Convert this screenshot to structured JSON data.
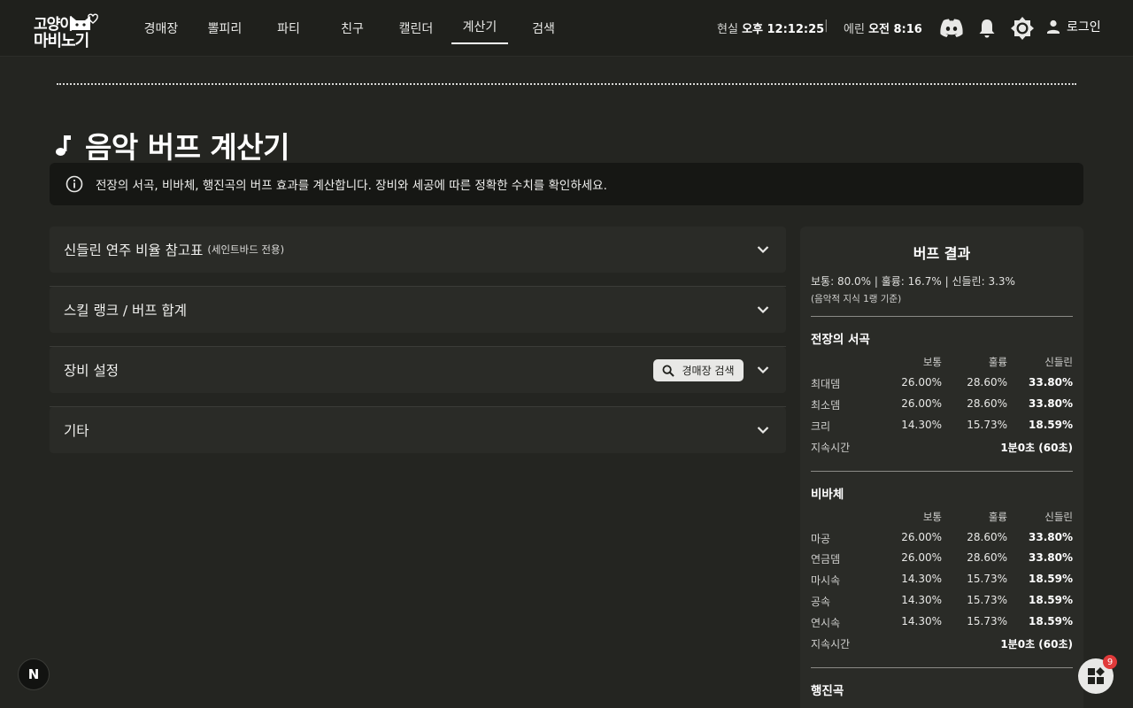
{
  "header": {
    "logo_line1": "고양이",
    "logo_line2": "마비노기",
    "nav": [
      {
        "label": "경매장"
      },
      {
        "label": "뽈피리"
      },
      {
        "label": "파티"
      },
      {
        "label": "친구"
      },
      {
        "label": "캘린더"
      },
      {
        "label": "계산기",
        "active": true
      },
      {
        "label": "검색"
      }
    ],
    "real_time_label": "현실",
    "real_time_value": "오후 12:12:25",
    "separator": "|",
    "erinn_time_label": "에린",
    "erinn_time_value": "오전 8:16",
    "icons": [
      "discord-icon",
      "bell-icon",
      "theme-toggle-icon",
      "user-icon"
    ],
    "login_label": "로그인"
  },
  "page": {
    "title": "음악 버프 계산기",
    "info": "전장의 서곡, 비바체, 행진곡의 버프 효과를 계산합니다. 장비와 세공에 따른 정확한 수치를 확인하세요."
  },
  "accordions": [
    {
      "label": "신들린 연주 비율 참고표",
      "sub": "(세인트바드 전용)"
    },
    {
      "label": "스킬 랭크 / 버프 합계"
    },
    {
      "label": "장비 설정",
      "button": "경매장 검색"
    },
    {
      "label": "기타"
    }
  ],
  "result": {
    "title": "버프 결과",
    "ratio_text": "보통: 80.0% | 훌륭: 16.7% | 신들린: 3.3%",
    "ratio_note": "(음악적 지식 1랭 기준)",
    "col_headers": [
      "보통",
      "훌륭",
      "신들린"
    ],
    "sections": [
      {
        "title": "전장의 서곡",
        "rows": [
          {
            "name": "최대뎀",
            "v": [
              "26.00%",
              "28.60%",
              "33.80%"
            ]
          },
          {
            "name": "최소뎀",
            "v": [
              "26.00%",
              "28.60%",
              "33.80%"
            ]
          },
          {
            "name": "크리",
            "v": [
              "14.30%",
              "15.73%",
              "18.59%"
            ]
          }
        ],
        "duration_label": "지속시간",
        "duration": "1분0초 (60초)"
      },
      {
        "title": "비바체",
        "rows": [
          {
            "name": "마공",
            "v": [
              "26.00%",
              "28.60%",
              "33.80%"
            ]
          },
          {
            "name": "연금뎀",
            "v": [
              "26.00%",
              "28.60%",
              "33.80%"
            ]
          },
          {
            "name": "마시속",
            "v": [
              "14.30%",
              "15.73%",
              "18.59%"
            ]
          },
          {
            "name": "공속",
            "v": [
              "14.30%",
              "15.73%",
              "18.59%"
            ]
          },
          {
            "name": "연시속",
            "v": [
              "14.30%",
              "15.73%",
              "18.59%"
            ]
          }
        ],
        "duration_label": "지속시간",
        "duration": "1분0초 (60초)"
      },
      {
        "title": "행진곡"
      }
    ]
  },
  "floating": {
    "n_label": "N",
    "apps_badge": "9"
  }
}
